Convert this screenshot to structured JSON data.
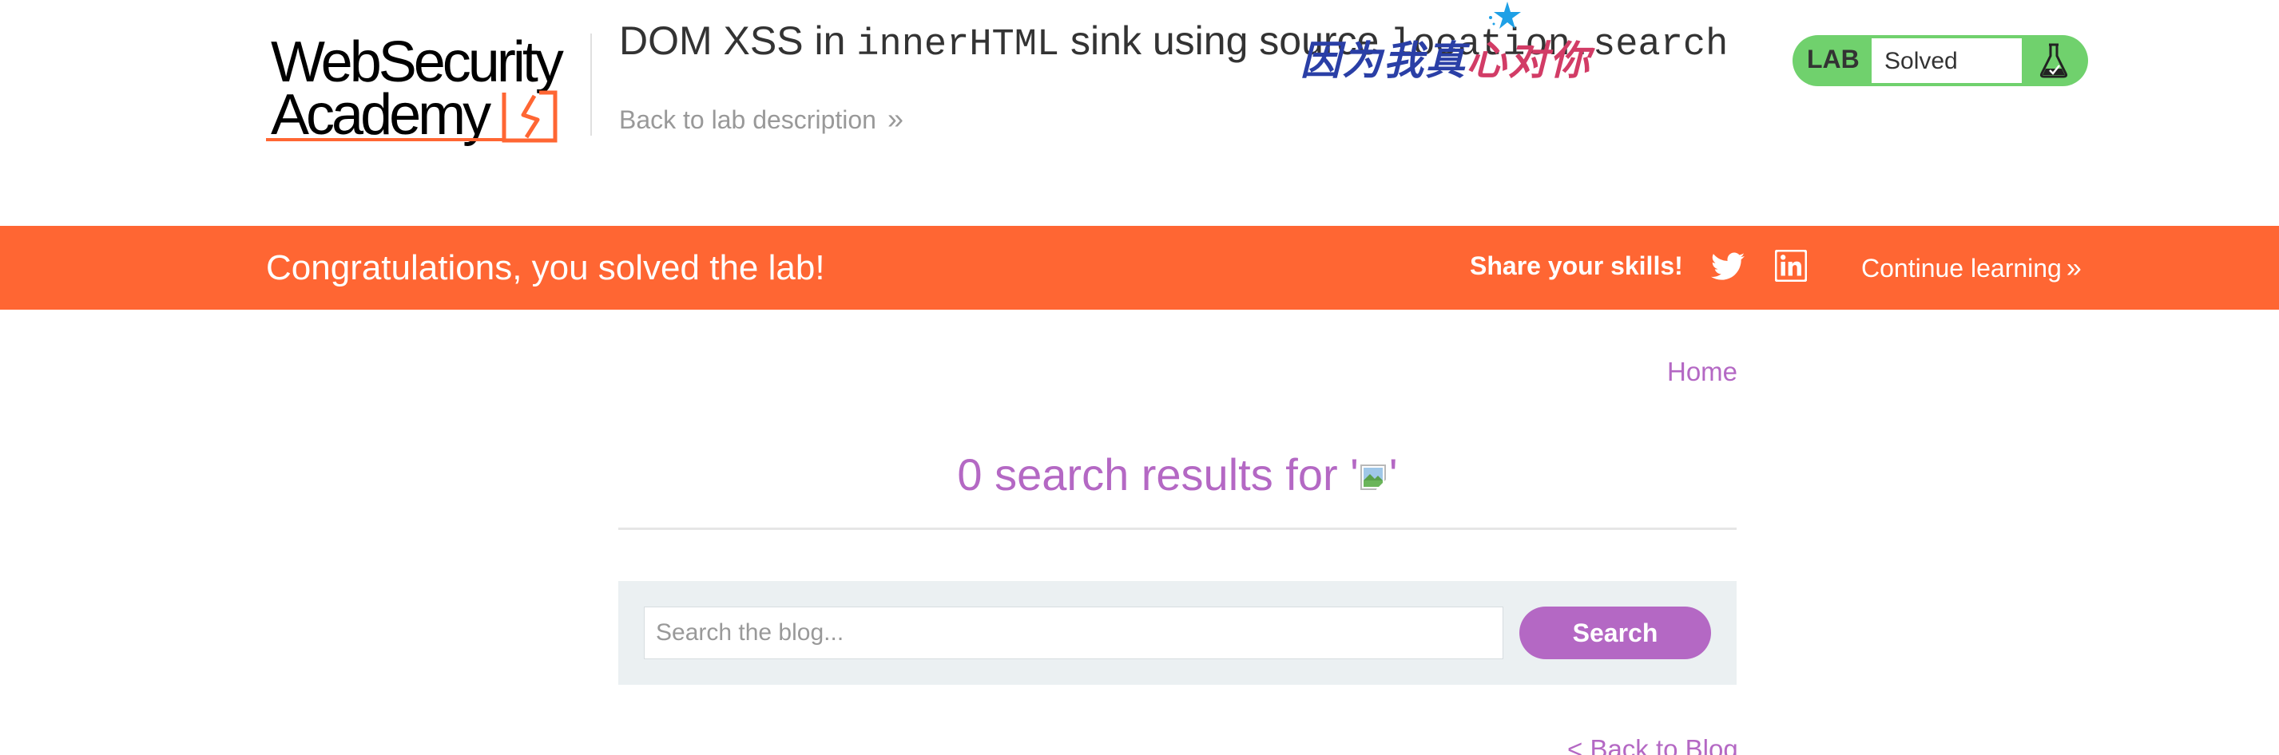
{
  "header": {
    "logo": {
      "line1": "WebSecurity",
      "line2": "Academy"
    },
    "lab_title_prefix": "DOM XSS in ",
    "lab_title_code": "innerHTML",
    "lab_title_suffix": " sink using source ",
    "lab_title_code2": "location.search",
    "back_to_description": "Back to lab description",
    "overlay_text_blue": "因为我真",
    "overlay_text_red": "心对你",
    "lab_status": {
      "label": "LAB",
      "status": "Solved"
    }
  },
  "banner": {
    "message": "Congratulations, you solved the lab!",
    "share_label": "Share your skills!",
    "continue_label": "Continue learning"
  },
  "main": {
    "home_link": "Home",
    "results_prefix": "0 search results for '",
    "results_suffix": "'",
    "search": {
      "placeholder": "Search the blog...",
      "value": "",
      "button_label": "Search"
    },
    "back_to_blog": "< Back to Blog"
  },
  "icons": {
    "header_decoration": "star-icon",
    "lab_status": "flask-icon",
    "share_twitter": "twitter-icon",
    "share_linkedin": "linkedin-icon",
    "results_image": "broken-image-icon",
    "back_chevron": "double-chevron-right-icon"
  },
  "colors": {
    "brand_orange": "#ff6633",
    "link_purple": "#b468c4",
    "lab_green": "#70d16d",
    "panel_gray": "#ebf0f2"
  }
}
